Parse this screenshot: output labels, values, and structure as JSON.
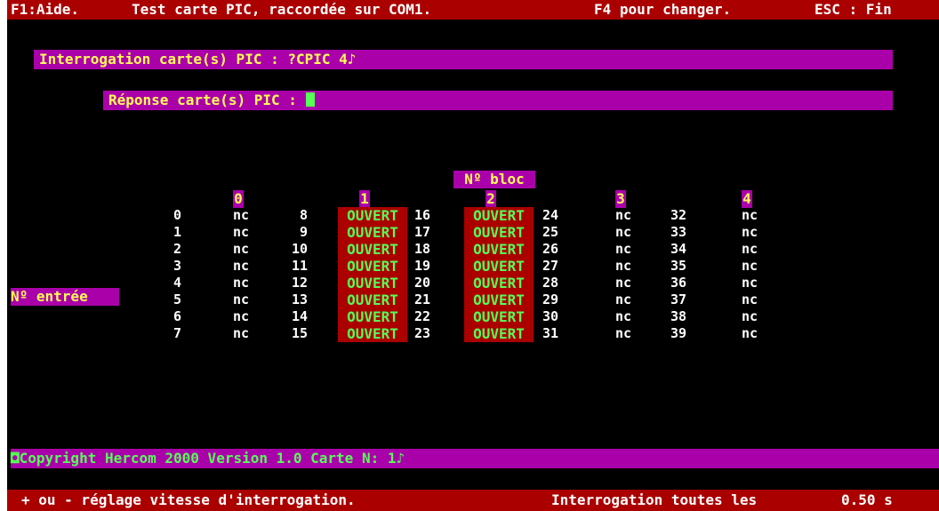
{
  "top_bar": {
    "help": "F1:Aide.",
    "title": "Test carte PIC, raccordée sur COM1.",
    "change": "F4 pour changer.",
    "exit": "ESC : Fin"
  },
  "query": {
    "label": "Interrogation carte(s) PIC : ?CPIC 4♪"
  },
  "response": {
    "label": "Réponse carte(s) PIC : "
  },
  "block_header": "Nº bloc",
  "entry_label": "Nº entrée",
  "columns": [
    {
      "block": "0",
      "numbers": [
        "0",
        "1",
        "2",
        "3",
        "4",
        "5",
        "6",
        "7"
      ],
      "states": [
        "nc",
        "nc",
        "nc",
        "nc",
        "nc",
        "nc",
        "nc",
        "nc"
      ]
    },
    {
      "block": "1",
      "numbers": [
        "8",
        "9",
        "10",
        "11",
        "12",
        "13",
        "14",
        "15"
      ],
      "states": [
        "OUVERT",
        "OUVERT",
        "OUVERT",
        "OUVERT",
        "OUVERT",
        "OUVERT",
        "OUVERT",
        "OUVERT"
      ]
    },
    {
      "block": "2",
      "numbers": [
        "16",
        "17",
        "18",
        "19",
        "20",
        "21",
        "22",
        "23"
      ],
      "states": [
        "OUVERT",
        "OUVERT",
        "OUVERT",
        "OUVERT",
        "OUVERT",
        "OUVERT",
        "OUVERT",
        "OUVERT"
      ]
    },
    {
      "block": "3",
      "numbers": [
        "24",
        "25",
        "26",
        "27",
        "28",
        "29",
        "30",
        "31"
      ],
      "states": [
        "nc",
        "nc",
        "nc",
        "nc",
        "nc",
        "nc",
        "nc",
        "nc"
      ]
    },
    {
      "block": "4",
      "numbers": [
        "32",
        "33",
        "34",
        "35",
        "36",
        "37",
        "38",
        "39"
      ],
      "states": [
        "nc",
        "nc",
        "nc",
        "nc",
        "nc",
        "nc",
        "nc",
        "nc"
      ]
    }
  ],
  "copyright_bar": "◘Copyright Hercom 2000 Version 1.0 Carte N: 1♪",
  "bottom_bar": {
    "speed_hint": "+ ou - réglage vitesse d'interrogation.",
    "interval_label": "Interrogation toutes les",
    "interval_value": "0.50 s"
  },
  "colors": {
    "background": "#000000",
    "bar_red": "#aa0000",
    "bar_magenta": "#aa00aa",
    "text_green": "#55ff55",
    "text_yellow": "#ffff55",
    "text_white": "#ffffff"
  }
}
